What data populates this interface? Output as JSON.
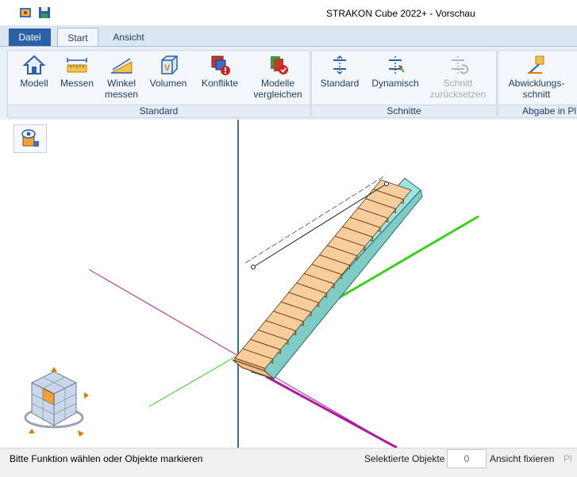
{
  "app": {
    "title": "STRAKON Cube 2022+  - Vorschau"
  },
  "tabs": {
    "file": "Datei",
    "start": "Start",
    "view": "Ansicht"
  },
  "ribbon": {
    "groups": {
      "standard": "Standard",
      "cuts": "Schnitte",
      "delivery": "Abgabe in Pl"
    },
    "buttons": {
      "model": "Modell",
      "measure": "Messen",
      "angle_1": "Winkel",
      "angle_2": "messen",
      "volume": "Volumen",
      "conflicts": "Konflikte",
      "compare_1": "Modelle",
      "compare_2": "vergleichen",
      "cut_standard": "Standard",
      "cut_dynamic": "Dynamisch",
      "reset_1": "Schnitt",
      "reset_2": "zurücksetzen",
      "develop_1": "Abwicklungs-",
      "develop_2": "schnitt"
    }
  },
  "icons": {
    "quick_access": [
      "app-icon",
      "save-icon"
    ],
    "ribbon": [
      "house-icon",
      "ruler-icon",
      "angle-ruler-icon",
      "volume-cube-icon",
      "conflict-icon",
      "compare-models-icon",
      "cut-standard-icon",
      "cut-dynamic-icon",
      "cut-reset-icon",
      "development-cut-icon"
    ],
    "viewport": [
      "visibility-icon",
      "view-cube-icon"
    ]
  },
  "colors": {
    "accent": "#2b5fa8",
    "axis_blue": "#2e6fd6",
    "axis_green": "#39d11a",
    "axis_magenta": "#b01aa0",
    "stair_step": "#f4c08a",
    "stair_stringer": "#9fe3e0"
  },
  "statusbar": {
    "message": "Bitte Funktion wählen oder Objekte markieren",
    "selected_label": "Selektierte Objekte",
    "selected_count": "0",
    "fix_view": "Ansicht fixieren",
    "truncated": "Pl"
  }
}
